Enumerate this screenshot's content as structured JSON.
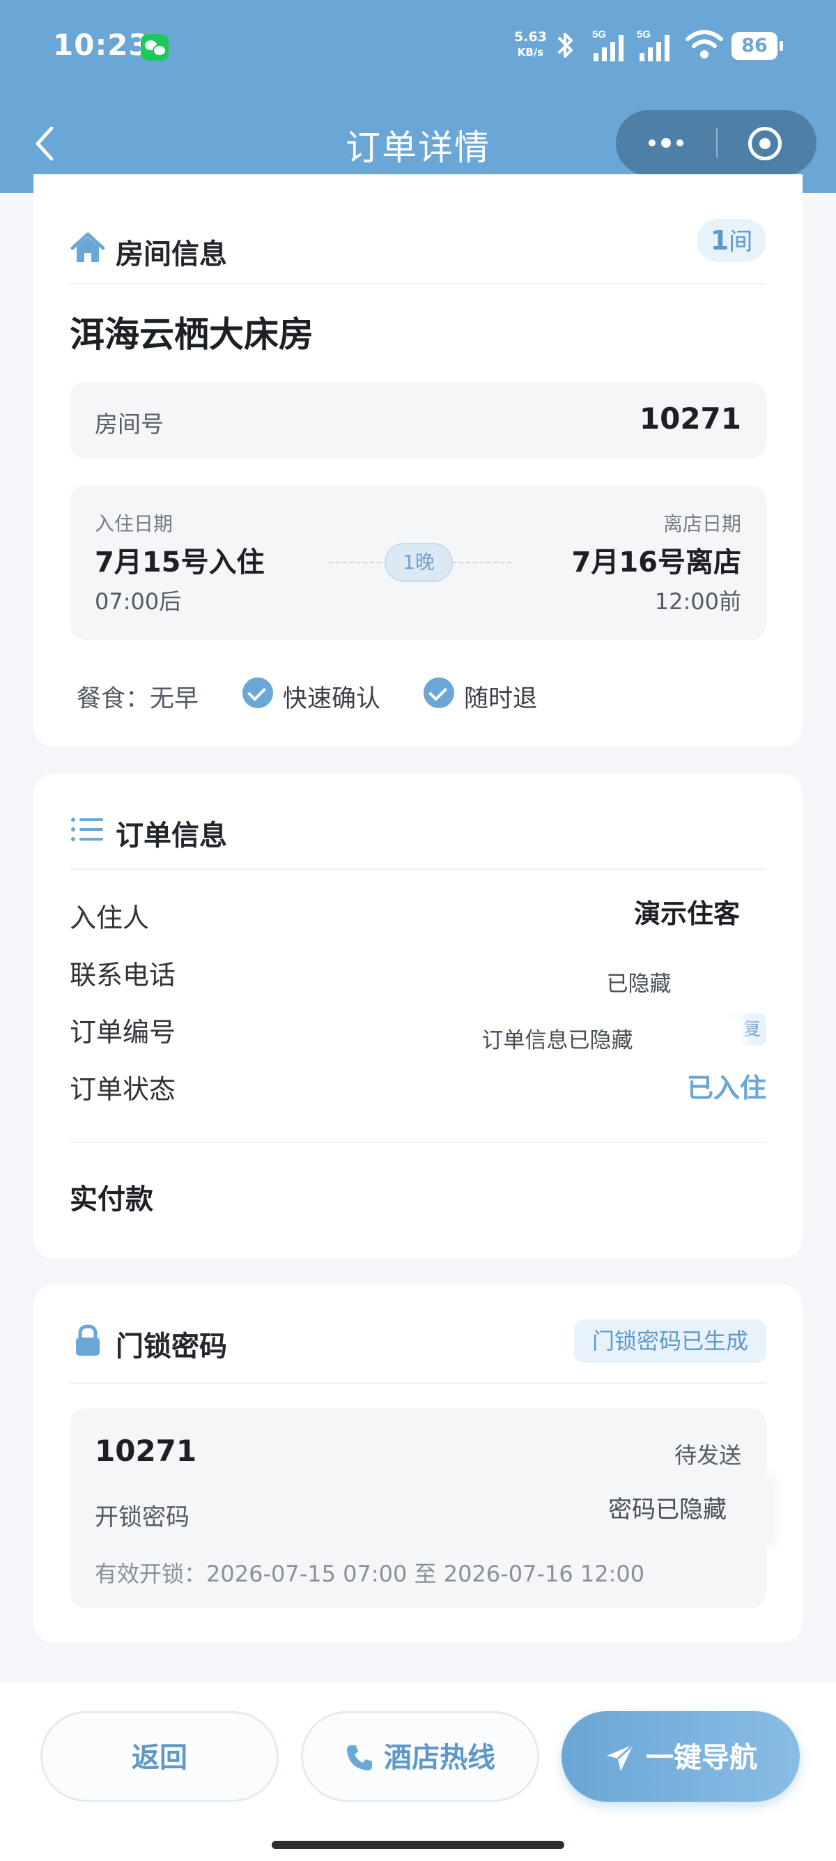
{
  "status_bar": {
    "time": "10:23",
    "net_speed_value": "5.63",
    "net_speed_unit": "KB/s",
    "signal_1": "5G",
    "signal_2": "5G",
    "battery": "86"
  },
  "nav": {
    "title": "订单详情",
    "back_icon": "chevron-left-icon",
    "more_icon": "more-dots-icon",
    "close_icon": "target-circle-icon"
  },
  "room_section": {
    "heading": "房间信息",
    "icon": "house-icon",
    "room_count_value": "1",
    "room_count_unit": "间",
    "room_name": "洱海云栖大床房",
    "room_no_label": "房间号",
    "room_no_value": "10271",
    "checkin_label": "入住日期",
    "checkin_date": "7月15号入住",
    "checkin_time": "07:00后",
    "nights": "1晚",
    "checkout_label": "离店日期",
    "checkout_date": "7月16号离店",
    "checkout_time": "12:00前",
    "meal": "餐食：无早",
    "tag_1": "快速确认",
    "tag_2": "随时退"
  },
  "order_section": {
    "heading": "订单信息",
    "icon": "list-icon",
    "guest_label": "入住人",
    "guest_value": "演示住客",
    "phone_label": "联系电话",
    "phone_value": "已隐藏",
    "order_no_label": "订单编号",
    "order_no_value": "订单信息已隐藏",
    "copy_label": "复制",
    "status_label": "订单状态",
    "status_value": "已入住",
    "paid_label": "实付款"
  },
  "lock_section": {
    "heading": "门锁密码",
    "icon": "lock-icon",
    "badge": "门锁密码已生成",
    "code": "10271",
    "send_state": "待发送",
    "unlock_label": "开锁密码",
    "unlock_value": "密码已隐藏",
    "valid_text": "有效开锁：2026-07-15 07:00 至 2026-07-16 12:00"
  },
  "bottom_bar": {
    "back_label": "返回",
    "hotline_label": "酒店热线",
    "hotline_icon": "phone-icon",
    "nav_label": "一键导航",
    "nav_icon": "navigation-arrow-icon"
  },
  "colors": {
    "accent": "#6aa6d6",
    "header_bg": "#6aa6d6",
    "page_bg": "#f4f6f9"
  }
}
